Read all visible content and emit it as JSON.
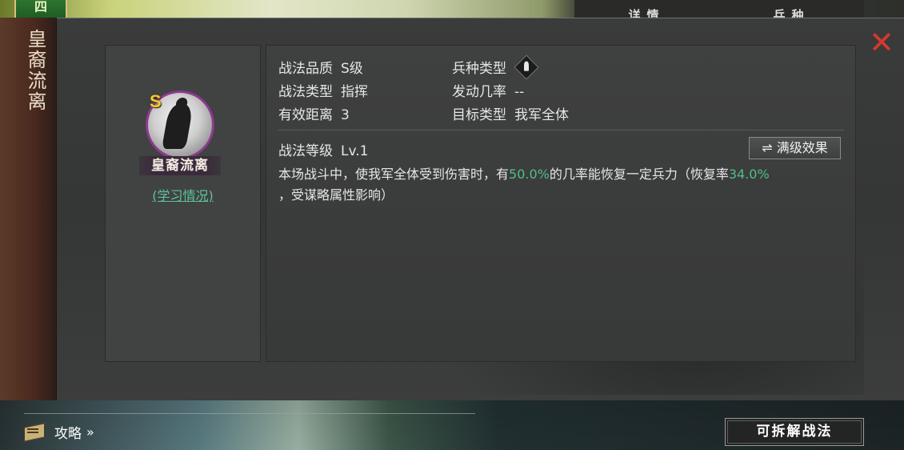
{
  "top": {
    "badge": "四",
    "tabs": [
      "详情",
      "兵种"
    ]
  },
  "banner": {
    "title": "皇裔流离"
  },
  "close_icon": "close-icon",
  "skill": {
    "grade_badge": "S",
    "name": "皇裔流离",
    "study_link": "(学习情况)"
  },
  "attributes": {
    "quality_label": "战法品质",
    "quality_value": "S级",
    "troop_label": "兵种类型",
    "type_label": "战法类型",
    "type_value": "指挥",
    "trigger_label": "发动几率",
    "trigger_value": "--",
    "range_label": "有效距离",
    "range_value": "3",
    "target_label": "目标类型",
    "target_value": "我军全体",
    "level_label": "战法等级",
    "level_value": "Lv.1"
  },
  "max_effect_button": "⇌ 满级效果",
  "description": {
    "part1": "本场战斗中，使我军全体受到伤害时，有",
    "rate1": "50.0%",
    "part2": "的几率能恢复一定兵力（恢复率",
    "rate2": "34.0%",
    "part3": "，受谋略属性影响）"
  },
  "bottom": {
    "guide_label": "攻略",
    "guide_chevron": "»",
    "dismantle_button": "可拆解战法"
  },
  "colors": {
    "highlight": "#4ec088",
    "close": "#d43a2f",
    "grade": "#f0c83c"
  }
}
